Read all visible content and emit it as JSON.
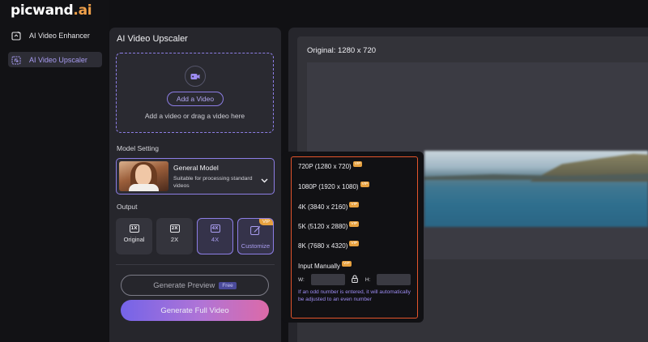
{
  "brand": {
    "name": "picwand",
    "suffix": ".ai"
  },
  "sidebar": {
    "items": [
      {
        "label": "AI Video Enhancer",
        "icon": "video-enhance-icon",
        "active": false
      },
      {
        "label": "AI Video Upscaler",
        "icon": "video-upscale-icon",
        "active": true
      }
    ]
  },
  "panel": {
    "title": "AI Video Upscaler",
    "upload": {
      "icon": "video-camera-icon",
      "button_label": "Add a Video",
      "hint": "Add a video or drag a video here"
    },
    "model_setting": {
      "label": "Model Setting",
      "model_name": "General Model",
      "model_desc": "Suitable for processing standard videos"
    },
    "output": {
      "label": "Output",
      "options": [
        {
          "icon_text": "1X",
          "label": "Original"
        },
        {
          "icon_text": "2X",
          "label": "2X"
        },
        {
          "icon_text": "4X",
          "label": "4X"
        },
        {
          "icon_text": "",
          "label": "Customize",
          "badge": "VIP"
        }
      ],
      "selected": "4X"
    },
    "generate_preview": {
      "label": "Generate Preview",
      "badge": "Free"
    },
    "generate_full": {
      "label": "Generate Full Video"
    }
  },
  "preview": {
    "original_label": "Original: 1280 x 720"
  },
  "resolution_menu": {
    "options": [
      {
        "label": "720P (1280 x 720)",
        "badge": "VIP"
      },
      {
        "label": "1080P (1920 x 1080)",
        "badge": "VIP"
      },
      {
        "label": "4K (3840 x 2160)",
        "badge": "VIP"
      },
      {
        "label": "5K (5120 x 2880)",
        "badge": "VIP"
      },
      {
        "label": "8K (7680 x 4320)",
        "badge": "VIP"
      }
    ],
    "manual": {
      "label": "Input Manually",
      "badge": "VIP",
      "width_label": "W:",
      "height_label": "H:",
      "width_value": "",
      "height_value": "",
      "note": "If an odd number is entered, it will automatically be adjusted to an even number"
    }
  },
  "colors": {
    "accent": "#8d7ee6",
    "vip": "#e7a13f",
    "highlight_border": "#e4552c"
  }
}
